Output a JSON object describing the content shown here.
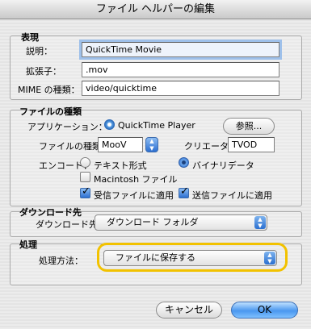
{
  "window": {
    "title": "ファイル ヘルパーの編集"
  },
  "representation": {
    "group_title": "表現",
    "description_label": "説明：",
    "description_value": "QuickTime Movie",
    "extension_label": "拡張子：",
    "extension_value": ".mov",
    "mime_label": "MIME の種類：",
    "mime_value": "video/quicktime"
  },
  "file_type": {
    "group_title": "ファイルの種類",
    "application_label": "アプリケーション：",
    "application_name": "QuickTime Player",
    "browse_label": "参照...",
    "type_label": "ファイルの種類：",
    "type_value": "MooV",
    "creator_label": "クリエータ：",
    "creator_value": "TVOD",
    "encode_label": "エンコード：",
    "text_format_label": "テキスト形式",
    "text_format_selected": false,
    "binary_label": "バイナリデータ",
    "binary_selected": true,
    "macintosh_file_label": "Macintosh ファイル",
    "macintosh_file_checked": false,
    "apply_receive_label": "受信ファイルに適用",
    "apply_receive_checked": true,
    "apply_send_label": "送信ファイルに適用",
    "apply_send_checked": true
  },
  "download": {
    "group_title": "ダウンロード先",
    "destination_label": "ダウンロード先：",
    "destination_value": "ダウンロード フォルダ"
  },
  "handling": {
    "group_title": "処理",
    "method_label": "処理方法：",
    "method_value": "ファイルに保存する"
  },
  "buttons": {
    "cancel_label": "キャンセル",
    "ok_label": "OK"
  },
  "colors": {
    "highlight": "#f2c200",
    "accent_blue": "#2d6fd1",
    "focus_ring": "#9ec0ea"
  },
  "icons": {
    "application": "quicktime-icon",
    "popup": "up-down-arrows-icon"
  }
}
